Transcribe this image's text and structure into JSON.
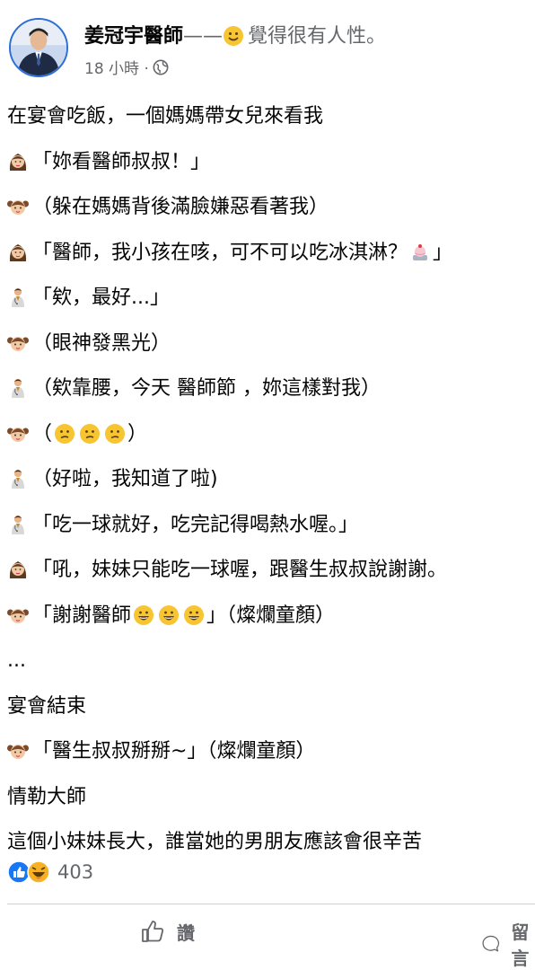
{
  "post": {
    "author": "姜冠宇醫師",
    "feeling_dash": "——",
    "feeling_text": "覺得很有人性。",
    "time": "18 小時 ·",
    "icons": {
      "feeling": "smile-emoji-icon",
      "privacy": "globe-icon"
    }
  },
  "lines": [
    {
      "text": "在宴會吃飯，一個媽媽帶女兒來看我"
    },
    {
      "icon": "mom-emoji-icon",
      "text": "「妳看醫師叔叔！」"
    },
    {
      "icon": "girl-emoji-icon",
      "text": "（躲在媽媽背後滿臉嫌惡看著我）"
    },
    {
      "icon": "mom-emoji-icon",
      "text": "「醫師，我小孩在咳，可不可以吃冰淇淋？",
      "tail_icon": "ice-cream-emoji-icon",
      "tail": "」"
    },
    {
      "icon": "doctor-emoji-icon",
      "text": "「欸，最好...」"
    },
    {
      "icon": "girl-emoji-icon",
      "text": "（眼神發黑光）"
    },
    {
      "icon": "doctor-emoji-icon",
      "text": "（欸靠腰，今天 醫師節 ，妳這樣對我）"
    },
    {
      "icon": "girl-emoji-icon",
      "text": "（",
      "mid_icons": [
        "confused-face-icon",
        "confused-face-icon",
        "confused-face-icon"
      ],
      "tail": "）"
    },
    {
      "icon": "doctor-emoji-icon",
      "text": "（好啦，我知道了啦)"
    },
    {
      "icon": "doctor-emoji-icon",
      "text": "「吃一球就好，吃完記得喝熱水喔。」"
    },
    {
      "icon": "mom-emoji-icon",
      "text": "「吼，妹妹只能吃一球喔，跟醫生叔叔說謝謝。"
    },
    {
      "icon": "girl-emoji-icon",
      "text": "「謝謝醫師",
      "mid_icons": [
        "grin-face-icon",
        "grin-face-icon",
        "grin-face-icon"
      ],
      "tail": "」（燦爛童顏）"
    },
    {
      "text": "..."
    },
    {
      "text": "宴會結束"
    },
    {
      "icon": "girl-emoji-icon",
      "text": "「醫生叔叔掰掰~」（燦爛童顏）"
    },
    {
      "text": "情勒大師"
    },
    {
      "text": "這個小妹妹長大，誰當她的男朋友應該會很辛苦"
    }
  ],
  "reactions": {
    "count": "403",
    "icons": [
      "like-reaction-icon",
      "haha-reaction-icon"
    ]
  },
  "actions": [
    {
      "label": "讚",
      "icon": "thumbs-up-icon"
    },
    {
      "label": "留言",
      "icon": "comment-icon"
    }
  ],
  "colors": {
    "brand_blue": "#1877f2",
    "meta_gray": "#65676b",
    "haha_yellow": "#f7b125"
  }
}
